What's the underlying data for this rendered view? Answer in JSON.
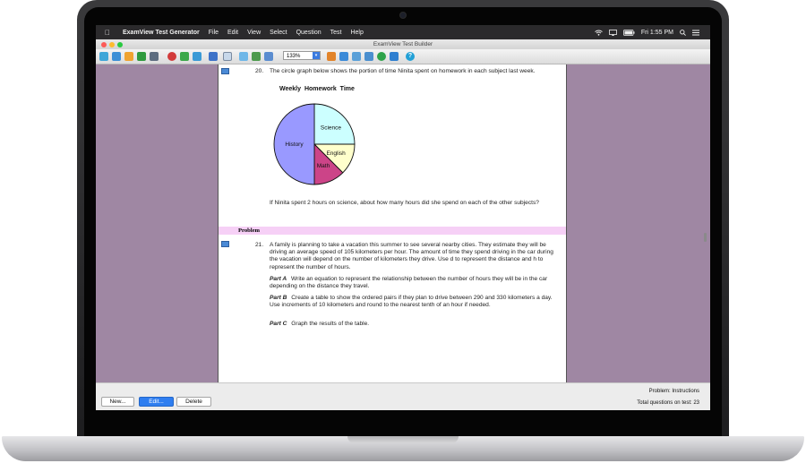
{
  "menubar": {
    "app_name": "ExamView Test Generator",
    "items": [
      "File",
      "Edit",
      "View",
      "Select",
      "Question",
      "Test",
      "Help"
    ],
    "clock": "Fri 1:55 PM"
  },
  "window": {
    "title": "ExamView Test Builder"
  },
  "toolbar": {
    "zoom": "133%"
  },
  "question20": {
    "number": "20.",
    "prompt": "The circle graph below shows the portion of time Ninita spent on homework in each subject last week.",
    "followup": "If Ninita spent 2 hours on science, about how many hours did she spend on each of the other subjects?"
  },
  "chart_data": {
    "type": "pie",
    "title": "Weekly Homework Time",
    "slices": [
      {
        "label": "Science",
        "value": 25,
        "color": "#ccffff"
      },
      {
        "label": "English",
        "value": 12.5,
        "color": "#ffffcc"
      },
      {
        "label": "Math",
        "value": 12.5,
        "color": "#cc4488"
      },
      {
        "label": "History",
        "value": 50,
        "color": "#9999ff"
      }
    ]
  },
  "section": {
    "label": "Problem"
  },
  "question21": {
    "number": "21.",
    "prompt": "A family is planning to take a vacation this summer to see several nearby cities. They estimate they will be driving an average speed of 105 kilometers per hour. The amount of time they spend driving in the car during the vacation will depend on the number of kilometers they drive. Use d to represent the distance and h to represent the number of hours.",
    "parts": [
      {
        "label": "Part A",
        "text": "Write an equation to represent the relationship between the number of hours they will be in the car depending on the distance they travel."
      },
      {
        "label": "Part B",
        "text": "Create a table to show the ordered pairs if they plan to drive between 290 and 330 kilometers a day. Use increments of 10 kilometers and round to the nearest tenth of an hour if needed."
      },
      {
        "label": "Part C",
        "text": "Graph the results of the table."
      }
    ]
  },
  "buttons": {
    "new": "New...",
    "edit": "Edit...",
    "delete": "Delete"
  },
  "status": {
    "problem": "Problem: Instructions",
    "total": "Total questions on test: 23"
  }
}
